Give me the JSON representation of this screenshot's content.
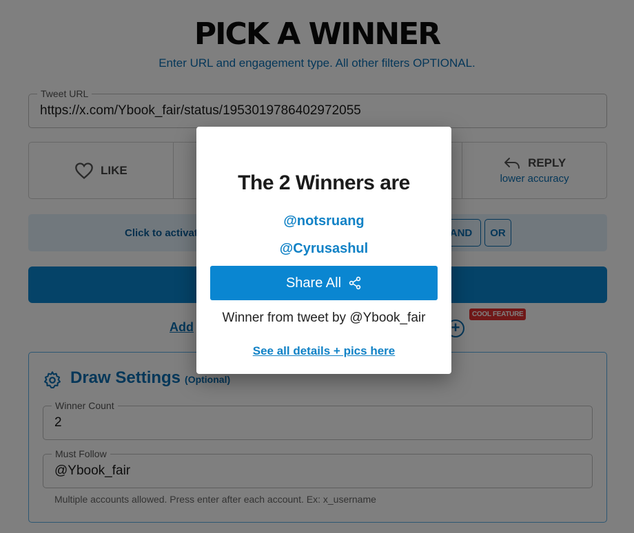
{
  "page": {
    "title": "PICK A WINNER",
    "subtitle": "Enter URL and engagement type. All other filters OPTIONAL."
  },
  "tweet_url": {
    "label": "Tweet URL",
    "value": "https://x.com/Ybook_fair/status/1953019786402972055"
  },
  "engagement": {
    "like_label": "LIKE",
    "reply_label": "REPLY",
    "reply_sub": "lower accuracy"
  },
  "filter_logic": {
    "hint": "Click to activat",
    "and_label": "AND",
    "or_label": "OR"
  },
  "extras": {
    "add_link": "Add",
    "cool_badge": "COOL FEATURE"
  },
  "draw_settings": {
    "title": "Draw Settings",
    "optional": "(Optional)",
    "winner_count_label": "Winner Count",
    "winner_count_value": "2",
    "must_follow_label": "Must Follow",
    "must_follow_value": "@Ybook_fair",
    "helper": "Multiple accounts allowed. Press enter after each account. Ex: x_username"
  },
  "modal": {
    "title": "The 2 Winners are",
    "winners": [
      "@notsruang",
      "@Cyrusashul"
    ],
    "share_label": "Share All",
    "from_text": "Winner from tweet by @Ybook_fair",
    "details_link": "See all details + pics here"
  },
  "colors": {
    "accent": "#0a86d1",
    "link": "#1182c6",
    "badge": "#e03030"
  }
}
